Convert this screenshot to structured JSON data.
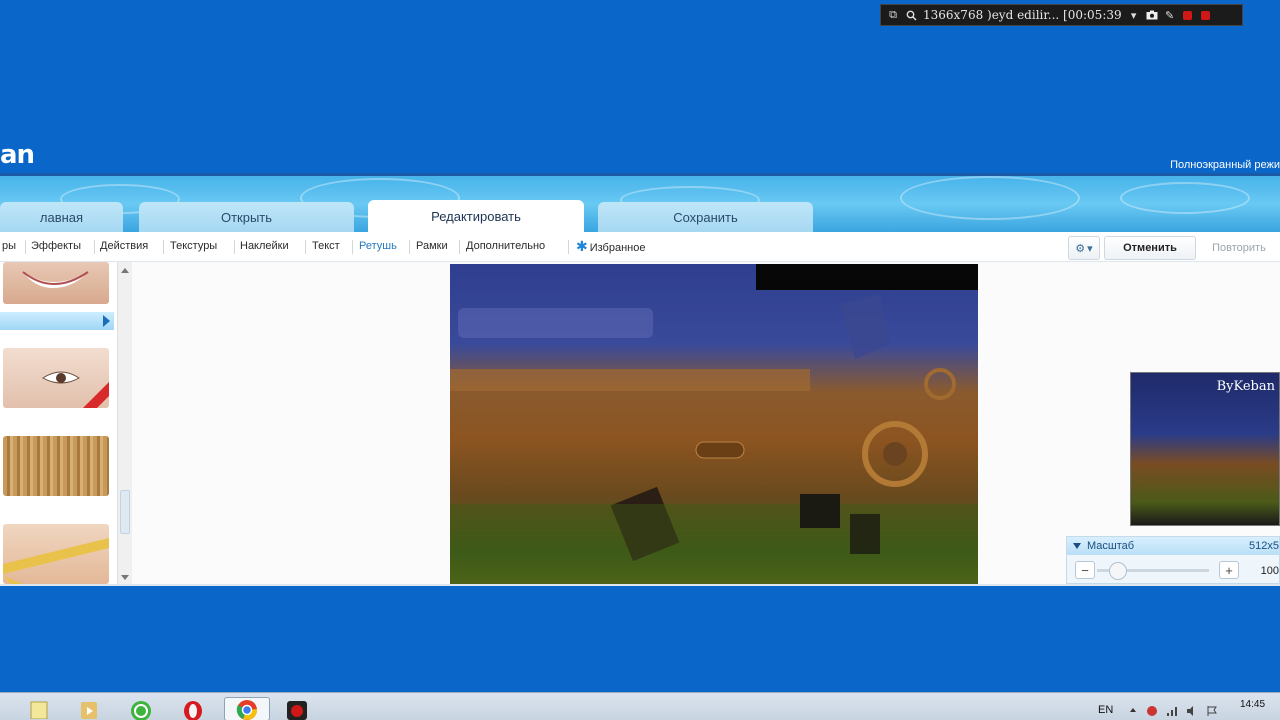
{
  "recorder": {
    "status_text": "1366x768 )eyd edilir... [00:05:39"
  },
  "app": {
    "logo": "an",
    "fullscreen_label": "Полноэкранный режи"
  },
  "tabs": [
    {
      "label": "лавная"
    },
    {
      "label": "Открыть"
    },
    {
      "label": "Редактировать"
    },
    {
      "label": "Сохранить"
    }
  ],
  "toolbar": {
    "items": [
      {
        "label": "ры"
      },
      {
        "label": "Эффекты"
      },
      {
        "label": "Действия"
      },
      {
        "label": "Текстуры"
      },
      {
        "label": "Наклейки"
      },
      {
        "label": "Текст"
      },
      {
        "label": "Ретушь"
      },
      {
        "label": "Рамки"
      },
      {
        "label": "Дополнительно"
      },
      {
        "label": "Избранное"
      }
    ],
    "undo_label": "Отменить",
    "redo_label": "Повторить"
  },
  "preview": {
    "brand": "ByKeban"
  },
  "zoom": {
    "label": "Масштаб",
    "size": "512x5",
    "value": "100"
  },
  "taskbar": {
    "lang": "EN",
    "time": "14:45"
  },
  "colors": {
    "brand_blue": "#0a66c8",
    "active_tool": "#2778c0"
  }
}
